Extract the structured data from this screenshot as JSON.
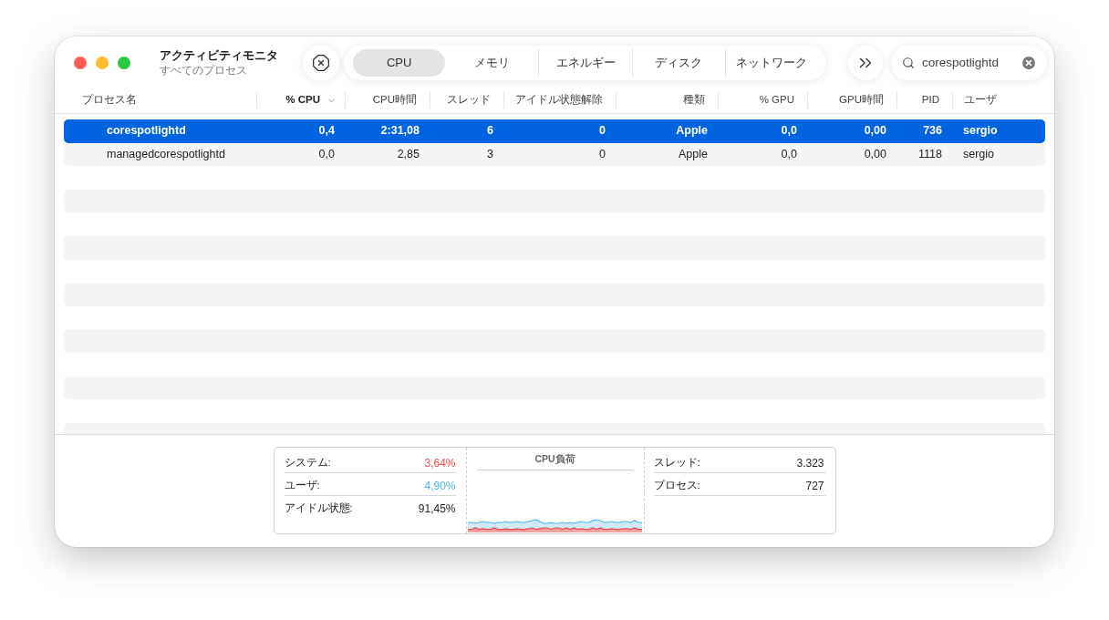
{
  "window": {
    "title": "アクティビティモニタ",
    "subtitle": "すべてのプロセス"
  },
  "tabs": [
    {
      "label": "CPU",
      "selected": true
    },
    {
      "label": "メモリ",
      "selected": false
    },
    {
      "label": "エネルギー",
      "selected": false
    },
    {
      "label": "ディスク",
      "selected": false
    },
    {
      "label": "ネットワーク",
      "selected": false
    }
  ],
  "search": {
    "value": "corespotlightd"
  },
  "table": {
    "columns": [
      {
        "label": "プロセス名",
        "sorted": false
      },
      {
        "label": "% CPU",
        "sorted": true
      },
      {
        "label": "CPU時間",
        "sorted": false
      },
      {
        "label": "スレッド",
        "sorted": false
      },
      {
        "label": "アイドル状態解除",
        "sorted": false
      },
      {
        "label": "種類",
        "sorted": false
      },
      {
        "label": "% GPU",
        "sorted": false
      },
      {
        "label": "GPU時間",
        "sorted": false
      },
      {
        "label": "PID",
        "sorted": false
      },
      {
        "label": "ユーザ",
        "sorted": false
      }
    ],
    "rows": [
      {
        "selected": true,
        "cells": [
          "corespotlightd",
          "0,4",
          "2:31,08",
          "6",
          "0",
          "Apple",
          "0,0",
          "0,00",
          "736",
          "sergio"
        ]
      },
      {
        "selected": false,
        "cells": [
          "managedcorespotlightd",
          "0,0",
          "2,85",
          "3",
          "0",
          "Apple",
          "0,0",
          "0,00",
          "1118",
          "sergio"
        ]
      }
    ]
  },
  "cpu_summary": {
    "usage": [
      {
        "label": "システム:",
        "value": "3,64%",
        "color": "#ef4d4d"
      },
      {
        "label": "ユーザ:",
        "value": "4,90%",
        "color": "#4ab6e6"
      },
      {
        "label": "アイドル状態:",
        "value": "91,45%",
        "color": "#222222"
      }
    ],
    "chart_title": "CPU負荷",
    "counts": [
      {
        "label": "スレッド:",
        "value": "3.323"
      },
      {
        "label": "プロセス:",
        "value": "727"
      }
    ]
  }
}
